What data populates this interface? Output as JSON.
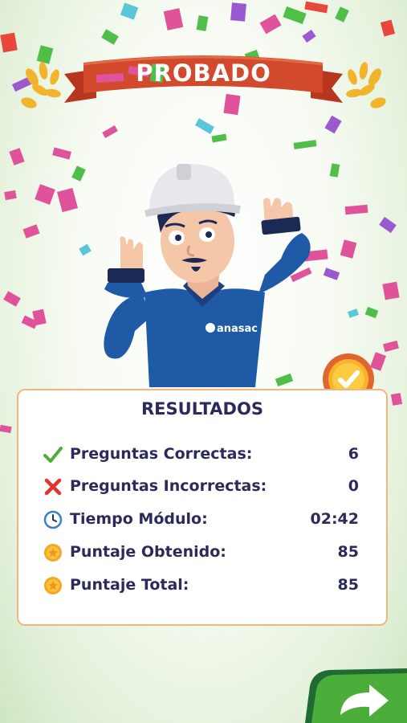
{
  "banner": {
    "title": "PROBADO"
  },
  "character": {
    "logo_text": "anasac"
  },
  "results": {
    "title": "RESULTADOS",
    "rows": [
      {
        "icon": "check-icon",
        "label": "Preguntas Correctas:",
        "value": "6"
      },
      {
        "icon": "x-icon",
        "label": "Preguntas Incorrectas:",
        "value": "0"
      },
      {
        "icon": "clock-icon",
        "label": "Tiempo Módulo:",
        "value": "02:42"
      },
      {
        "icon": "star-coin-icon",
        "label": "Puntaje Obtenido:",
        "value": "85"
      },
      {
        "icon": "star-coin-icon",
        "label": "Puntaje Total:",
        "value": "85"
      }
    ]
  },
  "next_button": {
    "icon": "arrow-right-icon"
  },
  "colors": {
    "accent_green": "#4cae3a",
    "banner_red": "#d2492b",
    "text_navy": "#2b2a5a",
    "card_border": "#f0b680"
  }
}
